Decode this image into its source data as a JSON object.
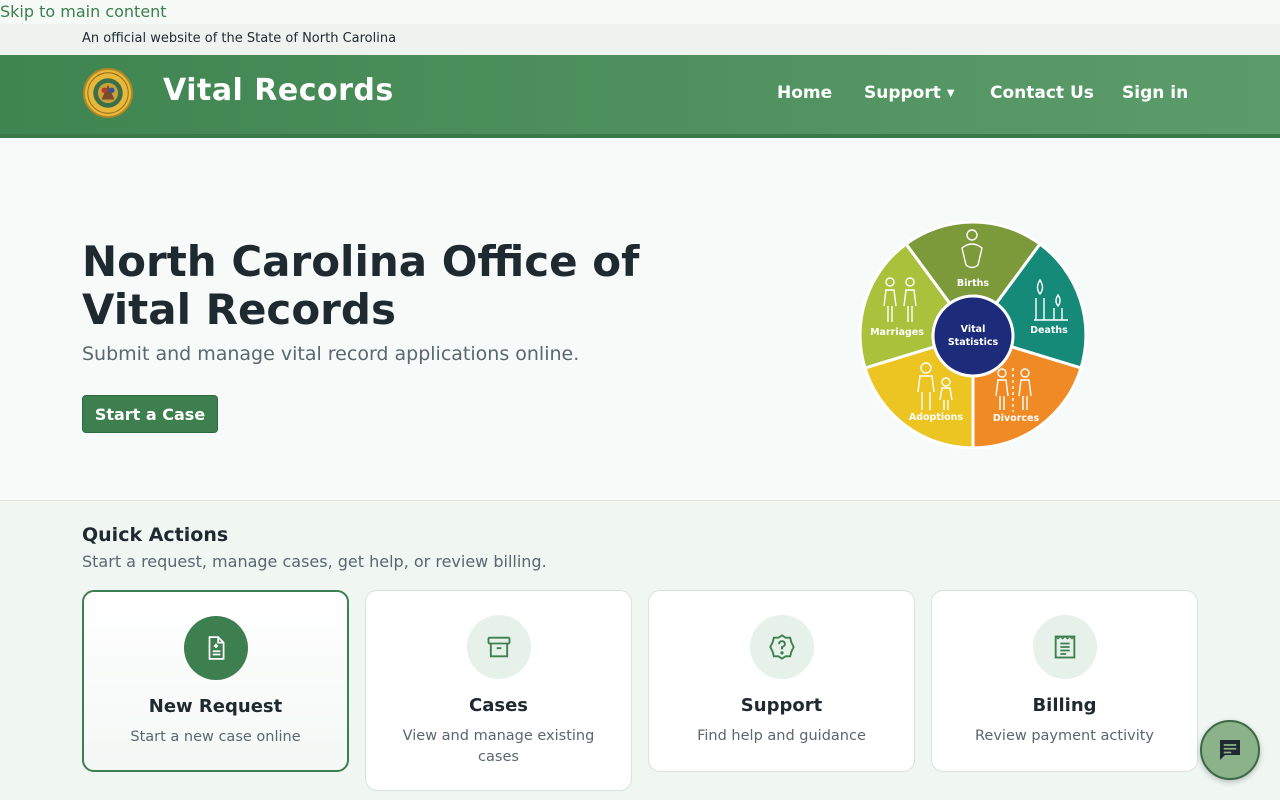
{
  "skip_link": "Skip to main content",
  "official_banner": "An official website of the State of North Carolina",
  "header": {
    "title": "Vital Records",
    "nav": {
      "home": "Home",
      "support": "Support",
      "contact": "Contact Us",
      "signin": "Sign in"
    }
  },
  "hero": {
    "title": "North Carolina Office of Vital Records",
    "subtitle": "Submit and manage vital record applications online.",
    "cta": "Start a Case",
    "wheel": {
      "center_line1": "Vital",
      "center_line2": "Statistics",
      "segments": {
        "births": "Births",
        "deaths": "Deaths",
        "divorces": "Divorces",
        "adoptions": "Adoptions",
        "marriages": "Marriages"
      },
      "colors": {
        "births": "#7c9a3a",
        "deaths": "#168a78",
        "divorces": "#ef8a24",
        "adoptions": "#ecc522",
        "marriages": "#a9c13b",
        "center": "#1c2c7a"
      }
    }
  },
  "quick_actions": {
    "title": "Quick Actions",
    "subtitle": "Start a request, manage cases, get help, or review billing.",
    "cards": [
      {
        "title": "New Request",
        "desc": "Start a new case online",
        "icon": "document-icon"
      },
      {
        "title": "Cases",
        "desc": "View and manage existing cases",
        "icon": "archive-icon"
      },
      {
        "title": "Support",
        "desc": "Find help and guidance",
        "icon": "help-badge-icon"
      },
      {
        "title": "Billing",
        "desc": "Review payment activity",
        "icon": "receipt-icon"
      }
    ]
  },
  "chat": {
    "icon": "chat-icon"
  },
  "colors": {
    "brand_green": "#3e7f4f",
    "header_green": "#4f9160",
    "link_green": "#3d7d4e"
  }
}
